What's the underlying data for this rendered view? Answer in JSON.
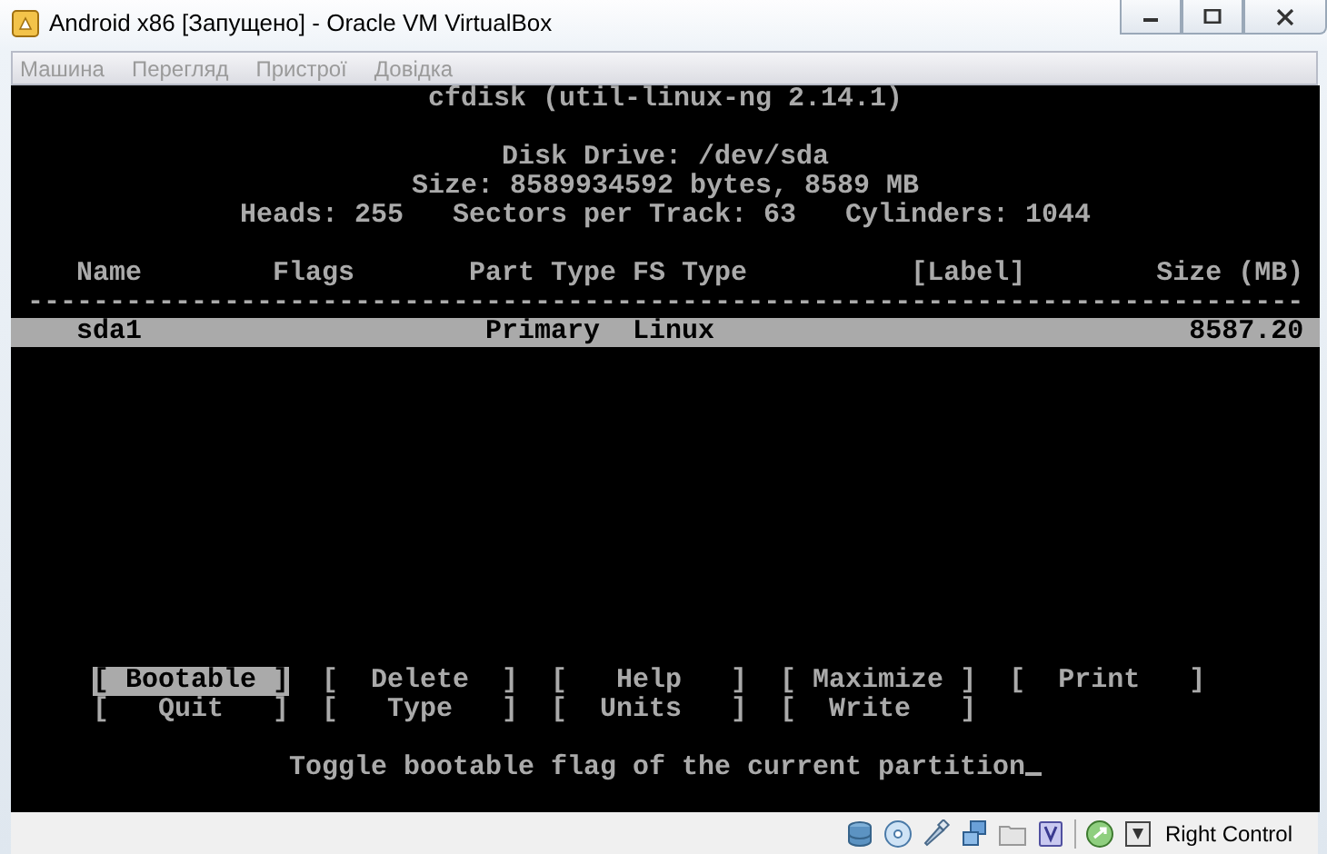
{
  "window": {
    "title": "Android x86 [Запущено] - Oracle VM VirtualBox"
  },
  "menu": [
    {
      "label": "Машина",
      "disabled": true
    },
    {
      "label": "Перегляд",
      "disabled": true
    },
    {
      "label": "Пристрої",
      "disabled": true
    },
    {
      "label": "Довідка",
      "disabled": true
    }
  ],
  "terminal": {
    "title": "cfdisk (util-linux-ng 2.14.1)",
    "disk_info": [
      "Disk Drive: /dev/sda",
      "Size: 8589934592 bytes, 8589 MB",
      "Heads: 255   Sectors per Track: 63   Cylinders: 1044"
    ],
    "columns": [
      "Name",
      "Flags",
      "Part Type",
      "FS Type",
      "[Label]",
      "Size (MB)"
    ],
    "separator": "------------------------------------------------------------------------------",
    "rows": [
      {
        "name": "sda1",
        "part_type": "Primary",
        "fs_type": "Linux",
        "size": "8587.20",
        "selected": true
      }
    ],
    "commands": [
      [
        {
          "label": "[ Bootable ]",
          "selected": true
        },
        {
          "label": "[  Delete  ]",
          "selected": false
        },
        {
          "label": "[   Help   ]",
          "selected": false
        },
        {
          "label": "[ Maximize ]",
          "selected": false
        },
        {
          "label": "[  Print   ]",
          "selected": false
        }
      ],
      [
        {
          "label": "[   Quit   ]",
          "selected": false
        },
        {
          "label": "[   Type   ]",
          "selected": false
        },
        {
          "label": "[  Units   ]",
          "selected": false
        },
        {
          "label": "[  Write   ]",
          "selected": false
        }
      ]
    ],
    "status": "Toggle bootable flag of the current partition"
  },
  "status_bar": {
    "host_key": "Right Control"
  }
}
